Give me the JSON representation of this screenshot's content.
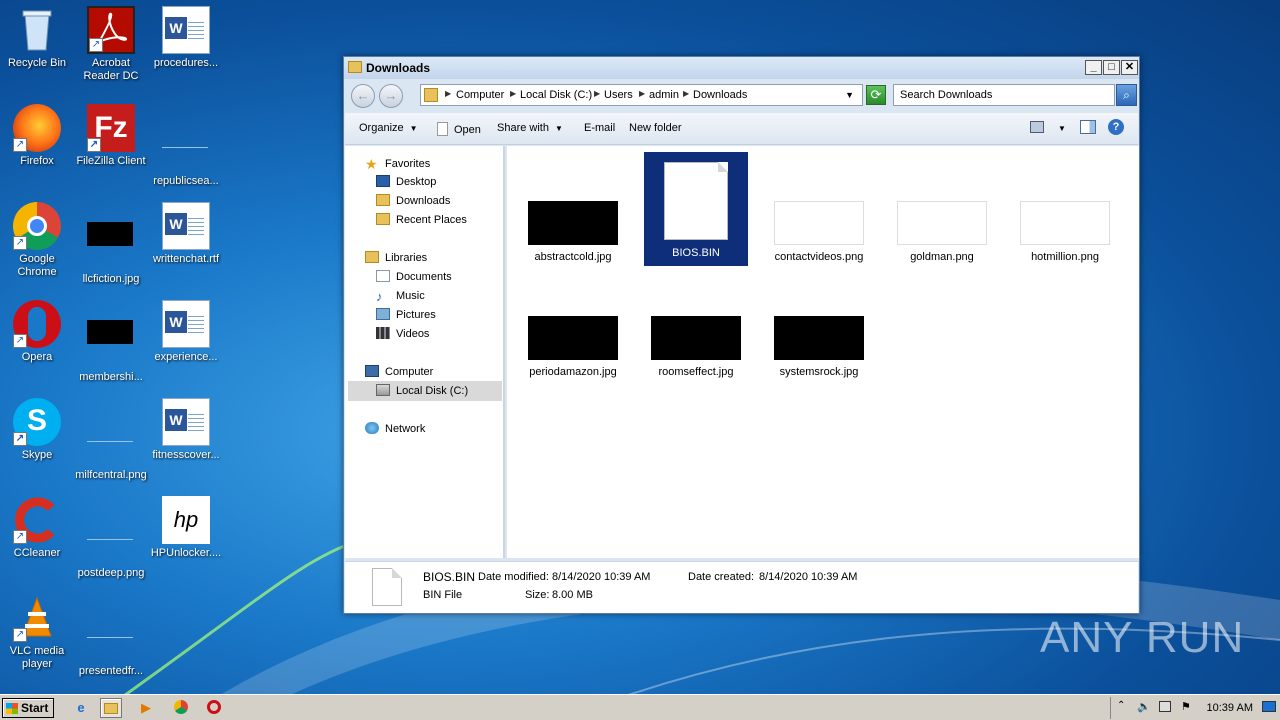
{
  "desktop": {
    "icons": [
      {
        "label": "Recycle Bin",
        "icon": "recycle-bin-icon"
      },
      {
        "label": "Acrobat Reader DC",
        "icon": "acrobat-icon"
      },
      {
        "label": "procedures...",
        "icon": "word-doc-icon"
      },
      {
        "label": "Firefox",
        "icon": "firefox-icon"
      },
      {
        "label": "FileZilla Client",
        "icon": "filezilla-icon"
      },
      {
        "label": "republicsea...",
        "icon": "file-icon"
      },
      {
        "label": "Google Chrome",
        "icon": "chrome-icon"
      },
      {
        "label": "llcfiction.jpg",
        "icon": "image-file-icon"
      },
      {
        "label": "writtenchat.rtf",
        "icon": "word-doc-icon"
      },
      {
        "label": "Opera",
        "icon": "opera-icon"
      },
      {
        "label": "membershi...",
        "icon": "image-file-icon"
      },
      {
        "label": "experience...",
        "icon": "word-doc-icon"
      },
      {
        "label": "Skype",
        "icon": "skype-icon"
      },
      {
        "label": "milfcentral.png",
        "icon": "image-file-icon"
      },
      {
        "label": "fitnesscover...",
        "icon": "word-doc-icon"
      },
      {
        "label": "CCleaner",
        "icon": "ccleaner-icon"
      },
      {
        "label": "postdeep.png",
        "icon": "image-file-icon"
      },
      {
        "label": "HPUnlocker....",
        "icon": "hp-icon"
      },
      {
        "label": "VLC media player",
        "icon": "vlc-icon"
      },
      {
        "label": "presentedfr...",
        "icon": "image-file-icon"
      }
    ]
  },
  "window": {
    "title": "Downloads",
    "address": {
      "crumbs": [
        "Computer",
        "Local Disk (C:)",
        "Users",
        "admin",
        "Downloads"
      ]
    },
    "search": {
      "placeholder": "Search Downloads"
    },
    "toolbar": {
      "organize": "Organize",
      "open": "Open",
      "share_with": "Share with",
      "email": "E-mail",
      "new_folder": "New folder"
    },
    "nav": {
      "favorites": "Favorites",
      "desktop": "Desktop",
      "downloads": "Downloads",
      "recent_places": "Recent Places",
      "libraries": "Libraries",
      "documents": "Documents",
      "music": "Music",
      "pictures": "Pictures",
      "videos": "Videos",
      "computer": "Computer",
      "local_disk": "Local Disk (C:)",
      "network": "Network"
    },
    "files": [
      {
        "name": "abstractcold.jpg",
        "thumb": "black"
      },
      {
        "name": "BIOS.BIN",
        "thumb": "blank-file",
        "selected": true
      },
      {
        "name": "contactvideos.png",
        "thumb": "white"
      },
      {
        "name": "goldman.png",
        "thumb": "white"
      },
      {
        "name": "hotmillion.png",
        "thumb": "white"
      },
      {
        "name": "periodamazon.jpg",
        "thumb": "black"
      },
      {
        "name": "roomseffect.jpg",
        "thumb": "black"
      },
      {
        "name": "systemsrock.jpg",
        "thumb": "black"
      }
    ],
    "details": {
      "name": "BIOS.BIN",
      "type": "BIN File",
      "date_modified_label": "Date modified:",
      "date_modified": "8/14/2020 10:39 AM",
      "date_created_label": "Date created:",
      "date_created": "8/14/2020 10:39 AM",
      "size_label": "Size:",
      "size": "8.00 MB"
    }
  },
  "taskbar": {
    "start": "Start",
    "clock": "10:39 AM"
  },
  "watermark": "ANY RUN"
}
